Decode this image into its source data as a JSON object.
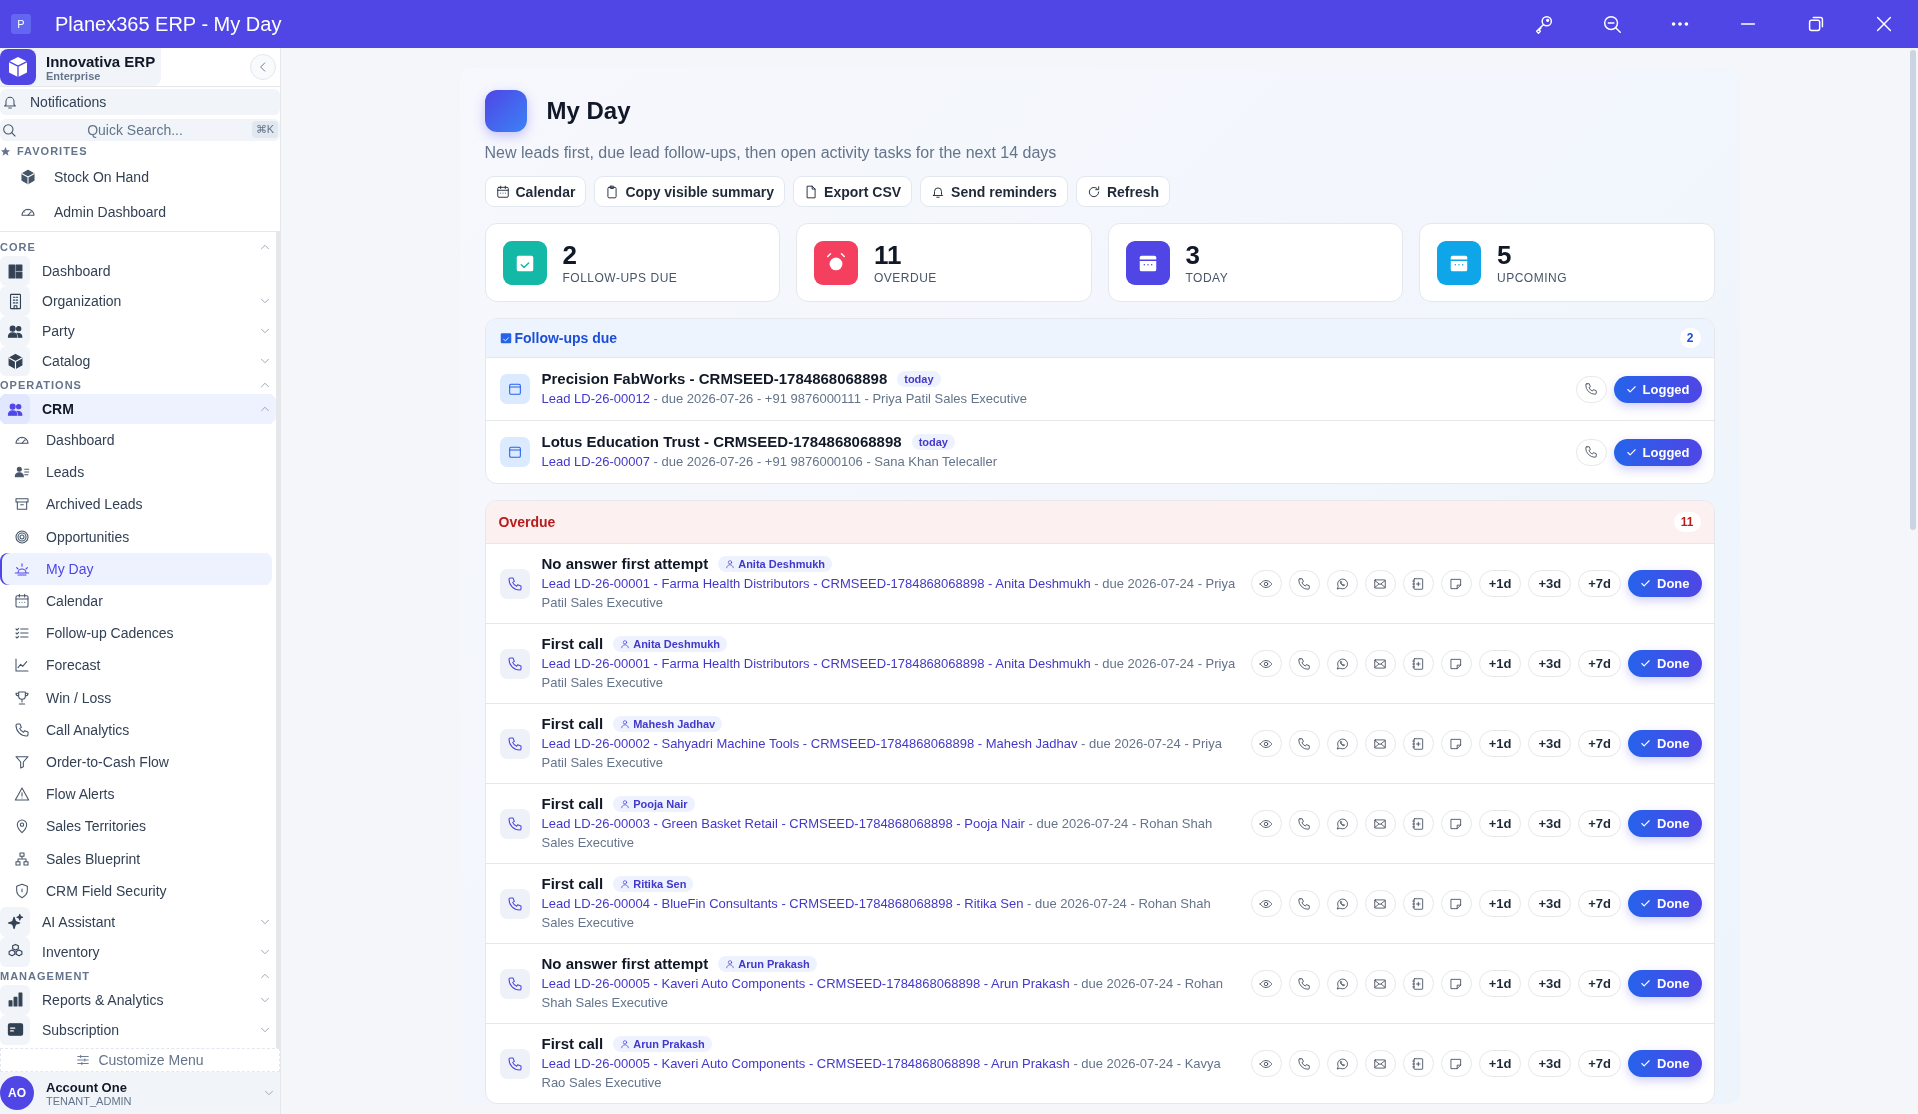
{
  "window": {
    "title": "Planex365 ERP - My Day",
    "app_icon_letter": "P"
  },
  "sidebar": {
    "brand": {
      "name": "Innovativa ERP",
      "plan": "Enterprise"
    },
    "notifications": "Notifications",
    "search": {
      "placeholder": "Quick Search...",
      "shortcut": "⌘K"
    },
    "favorites": {
      "label": "FAVORITES",
      "items": [
        {
          "label": "Stock On Hand",
          "selected": false
        },
        {
          "label": "Admin Dashboard",
          "selected": false
        }
      ]
    },
    "sections": [
      {
        "label": "CORE",
        "expanded": true,
        "items": [
          {
            "label": "Dashboard",
            "selected": false
          },
          {
            "label": "Organization",
            "selected": false,
            "expanded": false
          },
          {
            "label": "Party",
            "selected": false,
            "expanded": false
          },
          {
            "label": "Catalog",
            "selected": false,
            "expanded": false
          }
        ]
      },
      {
        "label": "OPERATIONS",
        "expanded": true,
        "items": [
          {
            "label": "CRM",
            "selected": true,
            "expanded": true,
            "children": [
              {
                "label": "Dashboard",
                "selected": false
              },
              {
                "label": "Leads",
                "selected": false
              },
              {
                "label": "Archived Leads",
                "selected": false
              },
              {
                "label": "Opportunities",
                "selected": false
              },
              {
                "label": "My Day",
                "selected": true
              },
              {
                "label": "Calendar",
                "selected": false
              },
              {
                "label": "Follow-up Cadences",
                "selected": false
              },
              {
                "label": "Forecast",
                "selected": false
              },
              {
                "label": "Win / Loss",
                "selected": false
              },
              {
                "label": "Call Analytics",
                "selected": false
              },
              {
                "label": "Order-to-Cash Flow",
                "selected": false
              },
              {
                "label": "Flow Alerts",
                "selected": false
              },
              {
                "label": "Sales Territories",
                "selected": false
              },
              {
                "label": "Sales Blueprint",
                "selected": false
              },
              {
                "label": "CRM Field Security",
                "selected": false
              }
            ]
          },
          {
            "label": "AI Assistant",
            "selected": false,
            "expanded": false
          },
          {
            "label": "Inventory",
            "selected": false,
            "expanded": false
          }
        ]
      },
      {
        "label": "MANAGEMENT",
        "expanded": true,
        "items": [
          {
            "label": "Reports & Analytics",
            "selected": false,
            "expanded": false
          },
          {
            "label": "Subscription",
            "selected": false,
            "expanded": false
          }
        ]
      }
    ],
    "customize": "Customize Menu",
    "account": {
      "initials": "AO",
      "name": "Account One",
      "role": "TENANT_ADMIN"
    }
  },
  "page": {
    "title": "My Day",
    "subtitle": "New leads first, due lead follow-ups, then open activity tasks for the next 14 days",
    "toolbar": [
      "Calendar",
      "Copy visible summary",
      "Export CSV",
      "Send reminders",
      "Refresh"
    ]
  },
  "stats": [
    {
      "value": "2",
      "label": "FOLLOW-UPS DUE",
      "color": "#14b8a6"
    },
    {
      "value": "11",
      "label": "OVERDUE",
      "color": "#f43f5e"
    },
    {
      "value": "3",
      "label": "TODAY",
      "color": "#4f46e5"
    },
    {
      "value": "5",
      "label": "UPCOMING",
      "color": "#0ea5e9"
    }
  ],
  "followups": {
    "title": "Follow-ups due",
    "count": "2",
    "rows": [
      {
        "title": "Precision FabWorks - CRMSEED-1784868068898",
        "tag": "today",
        "lead": "Lead LD-26-00012",
        "detail": " - due 2026-07-26 - +91 9876000111 - Priya Patil Sales Executive",
        "action": "Logged"
      },
      {
        "title": "Lotus Education Trust - CRMSEED-1784868068898",
        "tag": "today",
        "lead": "Lead LD-26-00007",
        "detail": " - due 2026-07-26 - +91 9876000106 - Sana Khan Telecaller",
        "action": "Logged"
      }
    ]
  },
  "overdue": {
    "title": "Overdue",
    "count": "11",
    "rows": [
      {
        "title": "No answer first attempt",
        "assignee": "Anita Deshmukh",
        "lead": "Lead LD-26-00001 - Farma Health Distributors - CRMSEED-1784868068898 - Anita Deshmukh",
        "detail": " - due 2026-07-24 - Priya Patil Sales Executive",
        "snooze": [
          "+1d",
          "+3d",
          "+7d"
        ],
        "action": "Done"
      },
      {
        "title": "First call",
        "assignee": "Anita Deshmukh",
        "lead": "Lead LD-26-00001 - Farma Health Distributors - CRMSEED-1784868068898 - Anita Deshmukh",
        "detail": " - due 2026-07-24 - Priya Patil Sales Executive",
        "snooze": [
          "+1d",
          "+3d",
          "+7d"
        ],
        "action": "Done"
      },
      {
        "title": "First call",
        "assignee": "Mahesh Jadhav",
        "lead": "Lead LD-26-00002 - Sahyadri Machine Tools - CRMSEED-1784868068898 - Mahesh Jadhav",
        "detail": " - due 2026-07-24 - Priya Patil Sales Executive",
        "snooze": [
          "+1d",
          "+3d",
          "+7d"
        ],
        "action": "Done"
      },
      {
        "title": "First call",
        "assignee": "Pooja Nair",
        "lead": "Lead LD-26-00003 - Green Basket Retail - CRMSEED-1784868068898 - Pooja Nair",
        "detail": " - due 2026-07-24 - Rohan Shah Sales Executive",
        "snooze": [
          "+1d",
          "+3d",
          "+7d"
        ],
        "action": "Done"
      },
      {
        "title": "First call",
        "assignee": "Ritika Sen",
        "lead": "Lead LD-26-00004 - BlueFin Consultants - CRMSEED-1784868068898 - Ritika Sen",
        "detail": " - due 2026-07-24 - Rohan Shah Sales Executive",
        "snooze": [
          "+1d",
          "+3d",
          "+7d"
        ],
        "action": "Done"
      },
      {
        "title": "No answer first attempt",
        "assignee": "Arun Prakash",
        "lead": "Lead LD-26-00005 - Kaveri Auto Components - CRMSEED-1784868068898 - Arun Prakash",
        "detail": " - due 2026-07-24 - Rohan Shah Sales Executive",
        "snooze": [
          "+1d",
          "+3d",
          "+7d"
        ],
        "action": "Done"
      },
      {
        "title": "First call",
        "assignee": "Arun Prakash",
        "lead": "Lead LD-26-00005 - Kaveri Auto Components - CRMSEED-1784868068898 - Arun Prakash",
        "detail": " - due 2026-07-24 - Kavya Rao Sales Executive",
        "snooze": [
          "+1d",
          "+3d",
          "+7d"
        ],
        "action": "Done"
      }
    ]
  }
}
